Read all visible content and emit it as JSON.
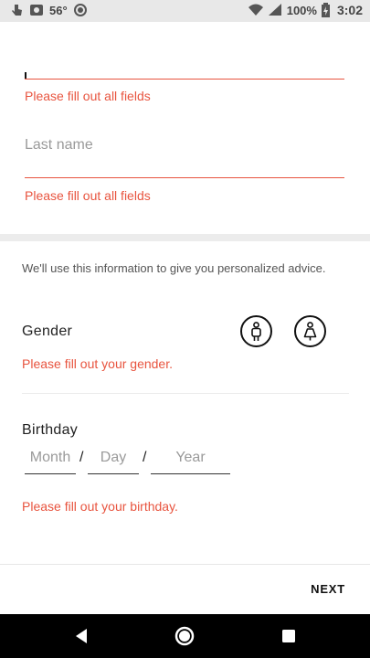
{
  "status_bar": {
    "temperature": "56°",
    "battery": "100%",
    "time": "3:02",
    "icons": [
      "touch-icon",
      "photo-icon",
      "circle-icon",
      "wifi-icon",
      "signal-icon",
      "battery-icon"
    ]
  },
  "form": {
    "first_name": {
      "value": "",
      "error": "Please fill out all fields"
    },
    "last_name": {
      "placeholder": "Last name",
      "error": "Please fill out all fields"
    }
  },
  "profile": {
    "info_text": "We'll use this information to give you personalized advice.",
    "gender": {
      "label": "Gender",
      "error": "Please fill out your gender.",
      "options": [
        "male-icon",
        "female-icon"
      ]
    },
    "birthday": {
      "label": "Birthday",
      "month_placeholder": "Month",
      "day_placeholder": "Day",
      "year_placeholder": "Year",
      "separator": "/",
      "error": "Please fill out your birthday."
    }
  },
  "footer": {
    "next_label": "NEXT"
  },
  "colors": {
    "error": "#e8543f",
    "accent": "#111111",
    "nav_bar": "#000000"
  },
  "nav": [
    "back-icon",
    "home-icon",
    "recents-icon"
  ]
}
